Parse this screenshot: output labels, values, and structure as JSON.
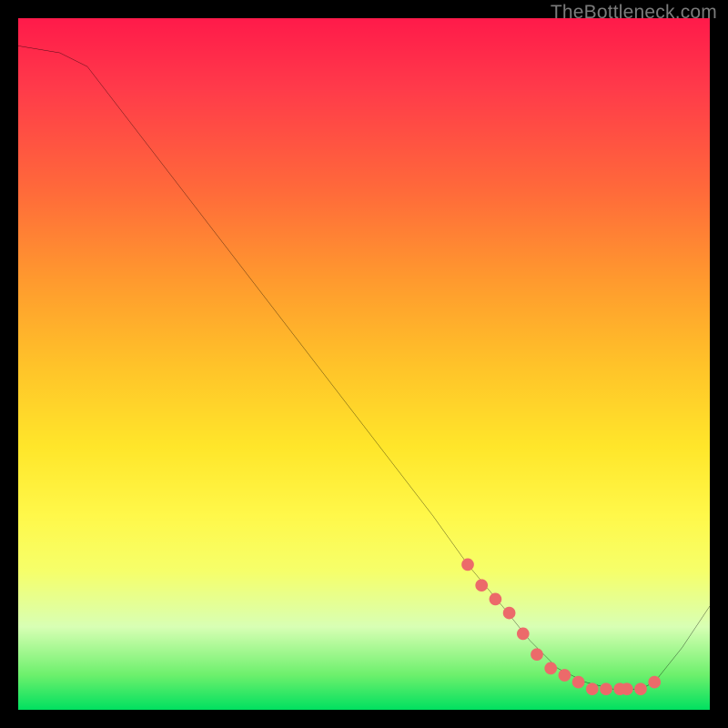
{
  "watermark": "TheBottleneck.com",
  "colors": {
    "background": "#000000",
    "curve": "#000000",
    "marker": "#ec6a6a",
    "gradient_top": "#ff1a4a",
    "gradient_bottom": "#00e060"
  },
  "chart_data": {
    "type": "line",
    "title": "",
    "xlabel": "",
    "ylabel": "",
    "xlim": [
      0,
      100
    ],
    "ylim": [
      0,
      100
    ],
    "curve": {
      "x": [
        0,
        6,
        10,
        20,
        30,
        40,
        50,
        60,
        65,
        70,
        74,
        78,
        82,
        86,
        88,
        90,
        92,
        96,
        100
      ],
      "y": [
        96,
        95,
        93,
        80,
        67,
        54,
        41,
        28,
        21,
        15,
        10,
        6,
        4,
        3,
        3,
        3,
        4,
        9,
        15
      ]
    },
    "markers": {
      "x": [
        65,
        67,
        69,
        71,
        73,
        75,
        77,
        79,
        81,
        83,
        85,
        87,
        88,
        90,
        92
      ],
      "y": [
        21,
        18,
        16,
        14,
        11,
        8,
        6,
        5,
        4,
        3,
        3,
        3,
        3,
        3,
        4
      ]
    }
  }
}
